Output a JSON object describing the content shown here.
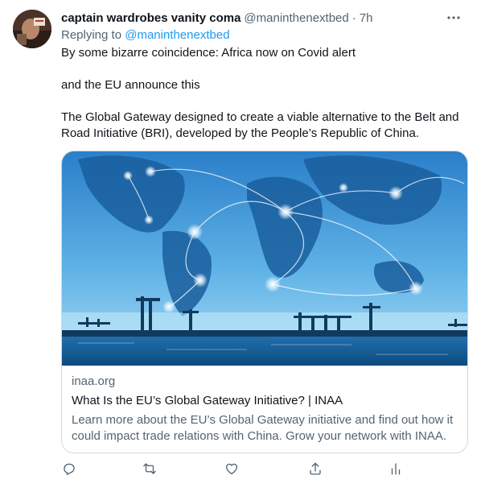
{
  "tweet": {
    "display_name": "captain wardrobes vanity coma",
    "handle": "@maninthenextbed",
    "separator": "·",
    "time": "7h",
    "replying_prefix": "Replying to ",
    "replying_to": "@maninthenextbed",
    "paragraphs": [
      "By some bizarre coincidence: Africa now on Covid alert",
      "and the EU announce this",
      "The Global Gateway designed to create a viable alternative to the Belt and Road Initiative (BRI), developed by the People’s Republic of China."
    ]
  },
  "card": {
    "domain": "inaa.org",
    "title": "What Is the EU’s Global Gateway Initiative? | INAA",
    "description": "Learn more about the EU’s Global Gateway initiative and find out how it could impact trade relations with China. Grow your network with INAA."
  },
  "actions": {
    "icons": [
      "reply-icon",
      "retweet-icon",
      "like-icon",
      "share-icon",
      "analytics-icon"
    ]
  },
  "colors": {
    "text": "#0f1419",
    "muted": "#536471",
    "accent": "#1d9bf0",
    "border": "#cfd9de"
  }
}
